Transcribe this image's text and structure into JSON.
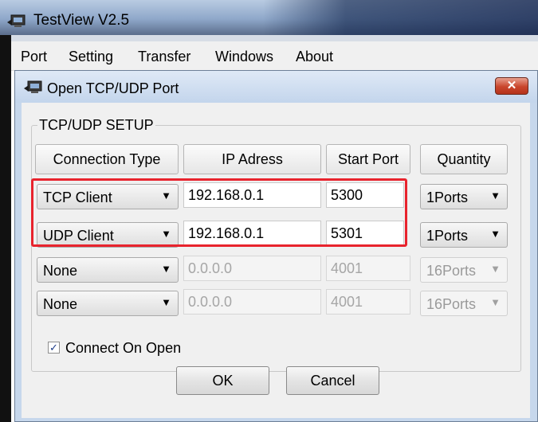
{
  "app": {
    "title": "TestView V2.5"
  },
  "menu": {
    "items": [
      "Port",
      "Setting",
      "Transfer",
      "Windows",
      "About"
    ]
  },
  "dialog": {
    "title": "Open TCP/UDP Port",
    "close_label": "✕",
    "group_label": "TCP/UDP SETUP",
    "headers": {
      "type": "Connection Type",
      "ip": "IP Adress",
      "port": "Start Port",
      "qty": "Quantity"
    },
    "rows": [
      {
        "type": "TCP Client",
        "ip": "192.168.0.1",
        "port": "5300",
        "qty": "1Ports",
        "enabled": true
      },
      {
        "type": "UDP Client",
        "ip": "192.168.0.1",
        "port": "5301",
        "qty": "1Ports",
        "enabled": true
      },
      {
        "type": "None",
        "ip": "0.0.0.0",
        "port": "4001",
        "qty": "16Ports",
        "enabled": false
      },
      {
        "type": "None",
        "ip": "0.0.0.0",
        "port": "4001",
        "qty": "16Ports",
        "enabled": false
      }
    ],
    "connect_on_open": {
      "label": "Connect On Open",
      "checked": true
    },
    "ok_label": "OK",
    "cancel_label": "Cancel"
  },
  "colors": {
    "highlight": "#e8232d",
    "close_button": "#c9452c"
  }
}
